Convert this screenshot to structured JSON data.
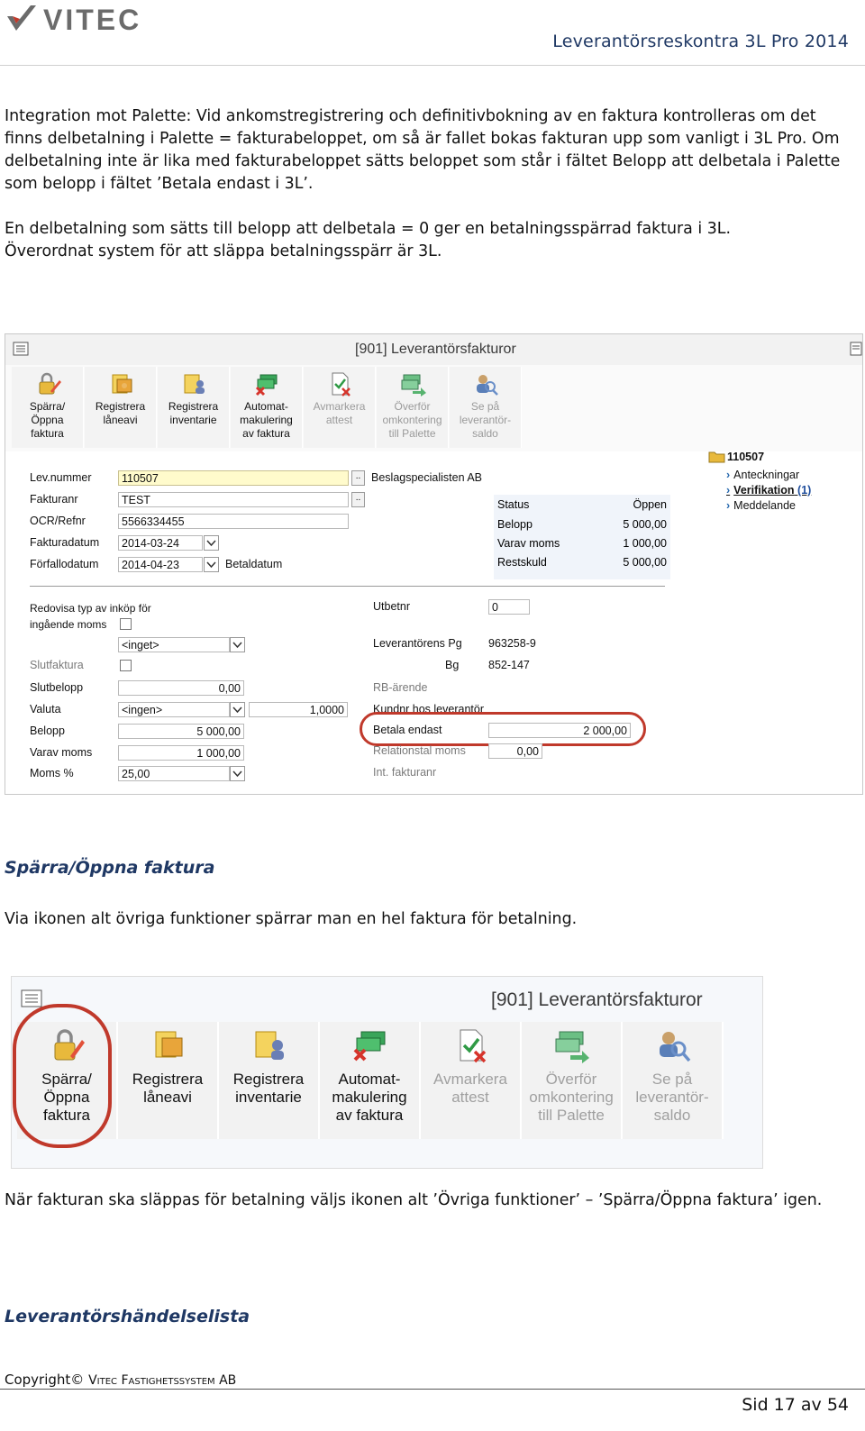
{
  "header": {
    "logo_text": "VITEC",
    "doc_title": "Leverantörsreskontra 3L Pro 2014"
  },
  "intro": {
    "p1": "Integration mot Palette: Vid ankomstregistrering och definitivbokning av en faktura kontrolleras om det finns delbetalning i Palette = fakturabeloppet, om så är fallet bokas fakturan upp som vanligt i 3L Pro. Om delbetalning inte är lika med fakturabeloppet sätts beloppet som står i fältet Belopp att delbetala i Palette som belopp i fältet ’Betala endast i 3L’.",
    "p2_line1": "En delbetalning som sätts till belopp att delbetala = 0 ger en betalningsspärrad faktura i 3L.",
    "p2_line2": "Överordnat system för att släppa betalningsspärr är 3L."
  },
  "screenshot1": {
    "window_title": "[901]  Leverantörsfakturor",
    "toolbar": [
      {
        "label": "Spärra/\nÖppna\nfaktura",
        "icon": "lock-pencil-icon",
        "enabled": true
      },
      {
        "label": "Registrera\nlåneavi",
        "icon": "gold-doc-icon",
        "enabled": true
      },
      {
        "label": "Registrera\ninventarie",
        "icon": "gold-doc-person-icon",
        "enabled": true
      },
      {
        "label": "Automat-\nmakulering\nav faktura",
        "icon": "money-x-icon",
        "enabled": true
      },
      {
        "label": "Avmarkera\nattest",
        "icon": "doc-check-x-icon",
        "enabled": false
      },
      {
        "label": "Överför\nomkontering\ntill Palette",
        "icon": "money-arrow-icon",
        "enabled": false
      },
      {
        "label": "Se på\nleverantör-\nsaldo",
        "icon": "person-search-icon",
        "enabled": false
      }
    ],
    "fields": {
      "lev_nummer_label": "Lev.nummer",
      "lev_nummer_value": "110507",
      "supplier_name": "Beslagspecialisten AB",
      "fakturanr_label": "Fakturanr",
      "fakturanr_value": "TEST",
      "ocr_label": "OCR/Refnr",
      "ocr_value": "5566334455",
      "fakturadatum_label": "Fakturadatum",
      "fakturadatum_value": "2014-03-24",
      "forfallodatum_label": "Förfallodatum",
      "forfallodatum_value": "2014-04-23",
      "betaldatum_label": "Betaldatum"
    },
    "status": {
      "rows": [
        {
          "k": "Status",
          "v": "Öppen"
        },
        {
          "k": "Belopp",
          "v": "5 000,00"
        },
        {
          "k": "Varav moms",
          "v": "1 000,00"
        },
        {
          "k": "Restskuld",
          "v": "5 000,00"
        }
      ]
    },
    "side": {
      "id": "110507",
      "links": [
        {
          "label": "Anteckningar",
          "extra": ""
        },
        {
          "label": "Verifikation",
          "extra": "(1)"
        },
        {
          "label": "Meddelande",
          "extra": ""
        }
      ]
    },
    "lower_left": {
      "redovisa_label1": "Redovisa typ av inköp för",
      "redovisa_label2": "ingående moms",
      "inget_value": "<inget>",
      "slutfaktura_label": "Slutfaktura",
      "slutbelopp_label": "Slutbelopp",
      "slutbelopp_value": "0,00",
      "valuta_label": "Valuta",
      "valuta_value": "<ingen>",
      "kurs_value": "1,0000",
      "belopp_label": "Belopp",
      "belopp_value": "5 000,00",
      "varav_moms_label": "Varav moms",
      "varav_moms_value": "1 000,00",
      "moms_label": "Moms %",
      "moms_value": "25,00"
    },
    "lower_right": {
      "utbetnr_label": "Utbetnr",
      "utbetnr_value": "0",
      "lev_pg_label": "Leverantörens Pg",
      "lev_pg_value": "963258-9",
      "bg_label": "Bg",
      "bg_value": "852-147",
      "rb_label": "RB-ärende",
      "kundnr_label": "Kundnr hos leverantör",
      "betala_endast_label": "Betala endast",
      "betala_endast_value": "2 000,00",
      "relationstal_label": "Relationstal moms",
      "relationstal_value": "0,00",
      "int_fakturanr_label": "Int. fakturanr"
    }
  },
  "section1": {
    "title": "Spärra/Öppna faktura",
    "text": "Via ikonen alt övriga funktioner spärrar man en hel faktura för betalning."
  },
  "screenshot2": {
    "window_title": "[901]  Leverantörsfakturor",
    "toolbar": [
      {
        "label": "Spärra/\nÖppna\nfaktura",
        "icon": "lock-pencil-icon",
        "enabled": true
      },
      {
        "label": "Registrera\nlåneavi",
        "icon": "gold-doc-icon",
        "enabled": true
      },
      {
        "label": "Registrera\ninventarie",
        "icon": "gold-doc-person-icon",
        "enabled": true
      },
      {
        "label": "Automat-\nmakulering\nav faktura",
        "icon": "money-x-icon",
        "enabled": true
      },
      {
        "label": "Avmarkera\nattest",
        "icon": "doc-check-x-icon",
        "enabled": false
      },
      {
        "label": "Överför\nomkontering\ntill Palette",
        "icon": "money-arrow-icon",
        "enabled": false
      },
      {
        "label": "Se på\nleverantör-\nsaldo",
        "icon": "person-search-icon",
        "enabled": false
      }
    ]
  },
  "after_text": "När fakturan ska släppas för betalning väljs ikonen alt ’Övriga funktioner’ – ’Spärra/Öppna faktura’ igen.",
  "section2": {
    "title": "Leverantörshändelselista"
  },
  "footer": {
    "copyright_prefix": "Copyright© ",
    "copyright_company": "Vitec Fastighetssystem AB",
    "page": "Sid 17 av 54"
  },
  "colors": {
    "heading": "#1f3864",
    "highlight_circle": "#c0392b",
    "link_blue": "#1f4e9c"
  }
}
